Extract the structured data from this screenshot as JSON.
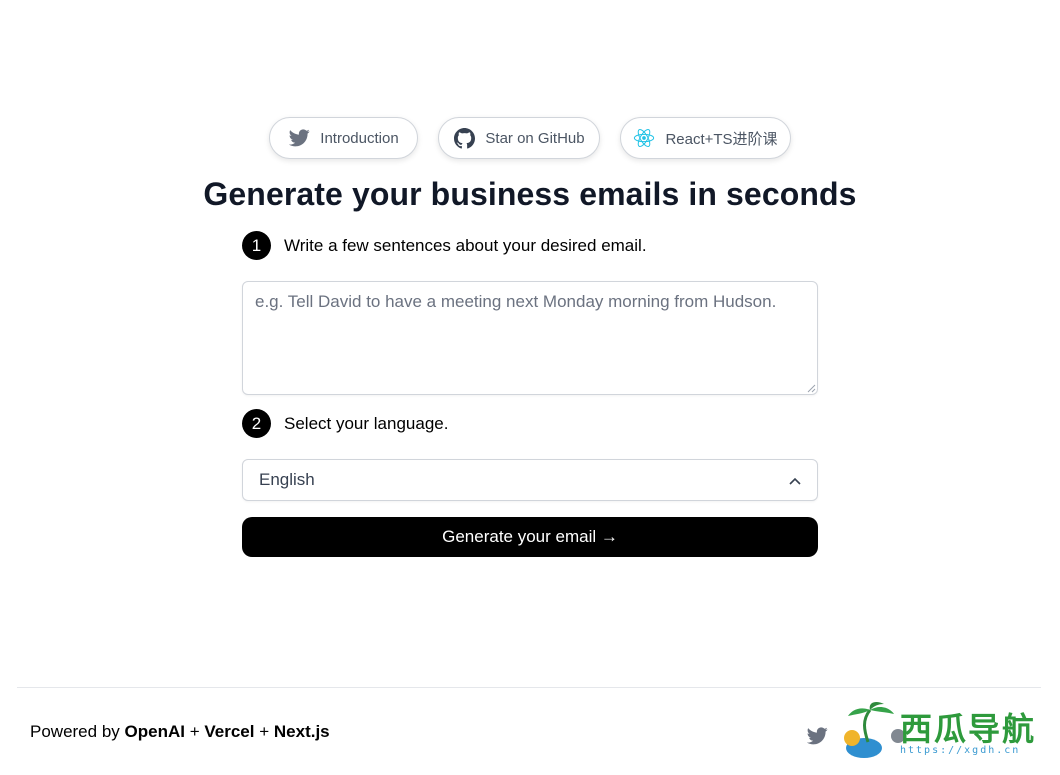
{
  "nav": {
    "introduction_label": "Introduction",
    "github_label": "Star on GitHub",
    "react_label": "React+TS进阶课"
  },
  "hero": {
    "title": "Generate your business emails in seconds"
  },
  "step1": {
    "number": "1",
    "label": "Write a few sentences about your desired email.",
    "placeholder": "e.g. Tell David to have a meeting next Monday morning from Hudson.",
    "value": ""
  },
  "step2": {
    "number": "2",
    "label": "Select your language.",
    "selected": "English"
  },
  "generate_button": {
    "label": "Generate your email →"
  },
  "footer": {
    "powered_by": "Powered by",
    "openai": "OpenAI",
    "plus1": "+",
    "vercel": "Vercel",
    "plus2": "+",
    "nextjs": "Next.js"
  },
  "watermark": {
    "text": "西瓜导航",
    "url": "https://xgdh.cn"
  },
  "colors": {
    "twitter_gray": "#6b7280",
    "react_blue": "#22c3e6",
    "button_black": "#000000",
    "border": "#d1d5db"
  }
}
